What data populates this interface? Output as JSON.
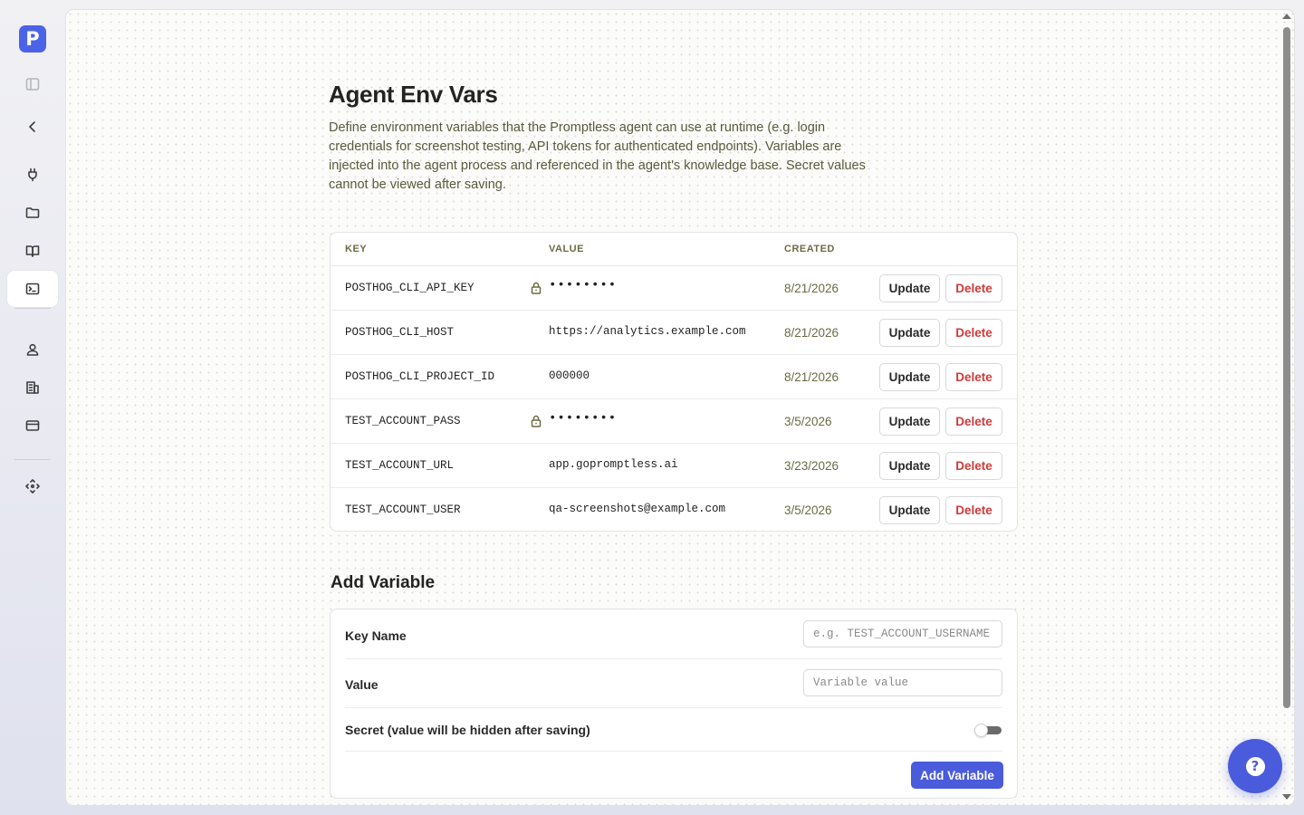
{
  "app": {
    "logo_letter": "P",
    "accent": "#4a5bdc"
  },
  "sidebar": {
    "items": [
      {
        "name": "sidebar-toggle",
        "icon": "panel-icon"
      },
      {
        "name": "collapse",
        "icon": "chevron-left-icon"
      },
      {
        "name": "integrations",
        "icon": "plug-icon"
      },
      {
        "name": "projects",
        "icon": "folder-icon"
      },
      {
        "name": "docs",
        "icon": "book-icon"
      },
      {
        "name": "env-vars",
        "icon": "terminal-icon",
        "active": true
      },
      {
        "name": "profile",
        "icon": "user-icon"
      },
      {
        "name": "organization",
        "icon": "building-icon"
      },
      {
        "name": "billing",
        "icon": "credit-card-icon"
      },
      {
        "name": "admin",
        "icon": "move-icon"
      }
    ]
  },
  "page": {
    "title": "Agent Env Vars",
    "description": "Define environment variables that the Promptless agent can use at runtime (e.g. login credentials for screenshot testing, API tokens for authenticated endpoints). Variables are injected into the agent process and referenced in the agent's knowledge base. Secret values cannot be viewed after saving."
  },
  "table": {
    "headers": {
      "key": "KEY",
      "value": "VALUE",
      "created": "CREATED"
    },
    "update_label": "Update",
    "delete_label": "Delete",
    "rows": [
      {
        "key": "POSTHOG_CLI_API_KEY",
        "value": "••••••••",
        "secret": true,
        "created": "8/21/2026"
      },
      {
        "key": "POSTHOG_CLI_HOST",
        "value": "https://analytics.example.com",
        "secret": false,
        "created": "8/21/2026"
      },
      {
        "key": "POSTHOG_CLI_PROJECT_ID",
        "value": "000000",
        "secret": false,
        "created": "8/21/2026"
      },
      {
        "key": "TEST_ACCOUNT_PASS",
        "value": "••••••••",
        "secret": true,
        "created": "3/5/2026"
      },
      {
        "key": "TEST_ACCOUNT_URL",
        "value": "app.gopromptless.ai",
        "secret": false,
        "created": "3/23/2026"
      },
      {
        "key": "TEST_ACCOUNT_USER",
        "value": "qa-screenshots@example.com",
        "secret": false,
        "created": "3/5/2026"
      }
    ]
  },
  "add_form": {
    "title": "Add Variable",
    "key_label": "Key Name",
    "key_value": "",
    "key_placeholder": "e.g. TEST_ACCOUNT_USERNAME",
    "value_label": "Value",
    "value_value": "",
    "value_placeholder": "Variable value",
    "secret_label": "Secret (value will be hidden after saving)",
    "secret_on": false,
    "submit_label": "Add Variable"
  },
  "help": {
    "glyph": "?"
  }
}
